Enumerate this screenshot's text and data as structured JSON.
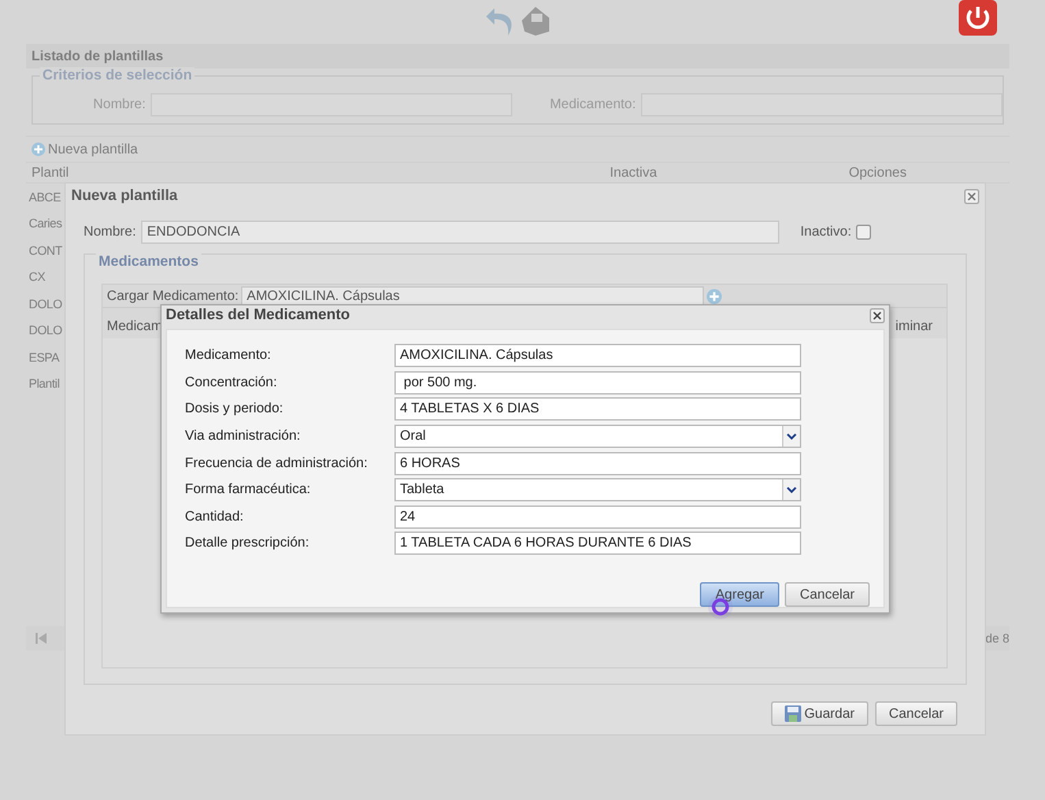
{
  "listing": {
    "title": "Listado de plantillas",
    "criteria": {
      "legend": "Criterios de selección",
      "fields": [
        {
          "label": "Nombre:"
        },
        {
          "label": "Medicamento:"
        }
      ]
    },
    "new_button": "Nueva plantilla",
    "table": {
      "columns": [
        "Plantil",
        "Inactiva",
        "Opciones"
      ],
      "rows": [
        "ABCE",
        "Caries",
        "CONT",
        "CX",
        "DOLO",
        "DOLO",
        "ESPA",
        "Plantil"
      ]
    },
    "pager": {
      "text": "de 8"
    }
  },
  "template_window": {
    "title": "Nueva plantilla",
    "name_label": "Nombre:",
    "name_value": "ENDODONCIA",
    "inactive_label": "Inactivo:",
    "inactive_checked": false,
    "medications": {
      "legend": "Medicamentos",
      "load_label": "Cargar Medicamento:",
      "load_value": "AMOXICILINA. Cápsulas",
      "columns": [
        "Medicam",
        "iminar"
      ]
    },
    "buttons": [
      {
        "label": "Guardar",
        "kind": "save"
      },
      {
        "label": "Cancelar",
        "kind": "plain"
      }
    ]
  },
  "detail_dialog": {
    "title": "Detalles del Medicamento",
    "fields": [
      {
        "label": "Medicamento:",
        "value": "AMOXICILINA. Cápsulas",
        "kind": "text"
      },
      {
        "label": "Concentración:",
        "value": " por 500 mg.",
        "kind": "text"
      },
      {
        "label": "Dosis y periodo:",
        "value": "4 TABLETAS X 6 DIAS",
        "kind": "text"
      },
      {
        "label": "Via administración:",
        "value": "Oral",
        "kind": "select"
      },
      {
        "label": "Frecuencia de administración:",
        "value": "6 HORAS",
        "kind": "text"
      },
      {
        "label": "Forma farmacéutica:",
        "value": "Tableta",
        "kind": "select"
      },
      {
        "label": "Cantidad:",
        "value": "24",
        "kind": "text"
      },
      {
        "label": "Detalle prescripción:",
        "value": "1 TABLETA CADA 6 HORAS DURANTE 6 DIAS",
        "kind": "text"
      }
    ],
    "buttons": [
      {
        "label": "Agregar",
        "selected": true
      },
      {
        "label": "Cancelar",
        "selected": false
      }
    ]
  }
}
